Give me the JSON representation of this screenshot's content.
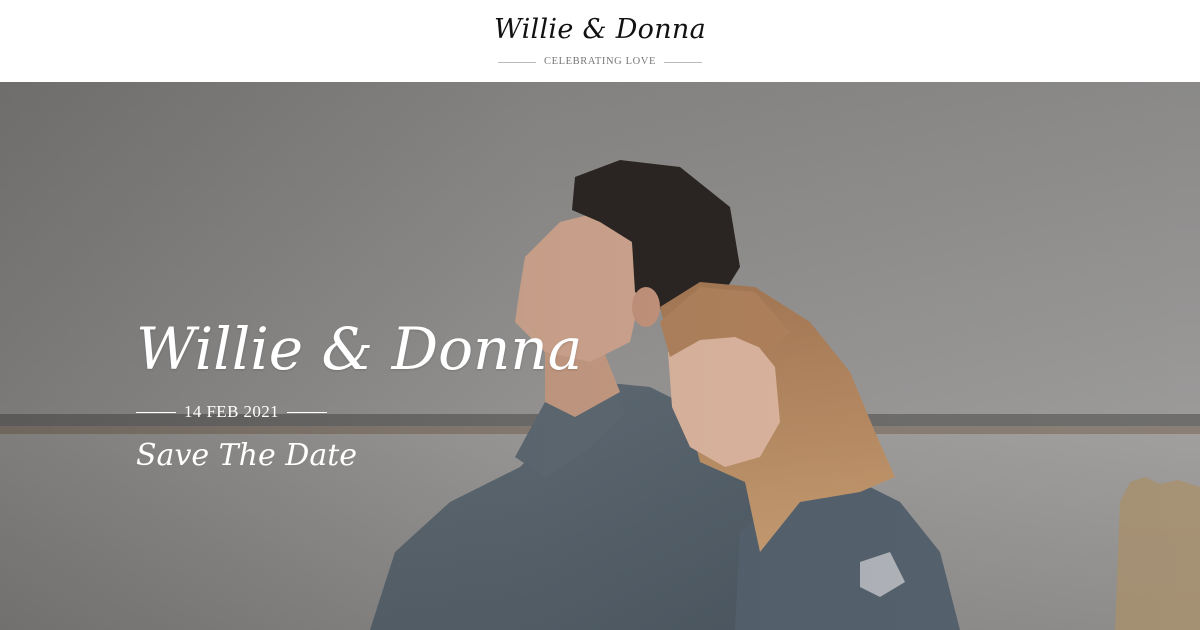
{
  "header": {
    "logo": "Willie & Donna",
    "tagline": "CELEBRATING LOVE"
  },
  "hero": {
    "title": "Willie & Donna",
    "date": "14 FEB 2021",
    "subtitle": "Save The Date",
    "photo_description": "couple-portrait-photo"
  },
  "colors": {
    "sky": "#8f8e8c",
    "water": "#a3a3a3",
    "text_light": "#ffffff",
    "text_dark": "#111111"
  }
}
